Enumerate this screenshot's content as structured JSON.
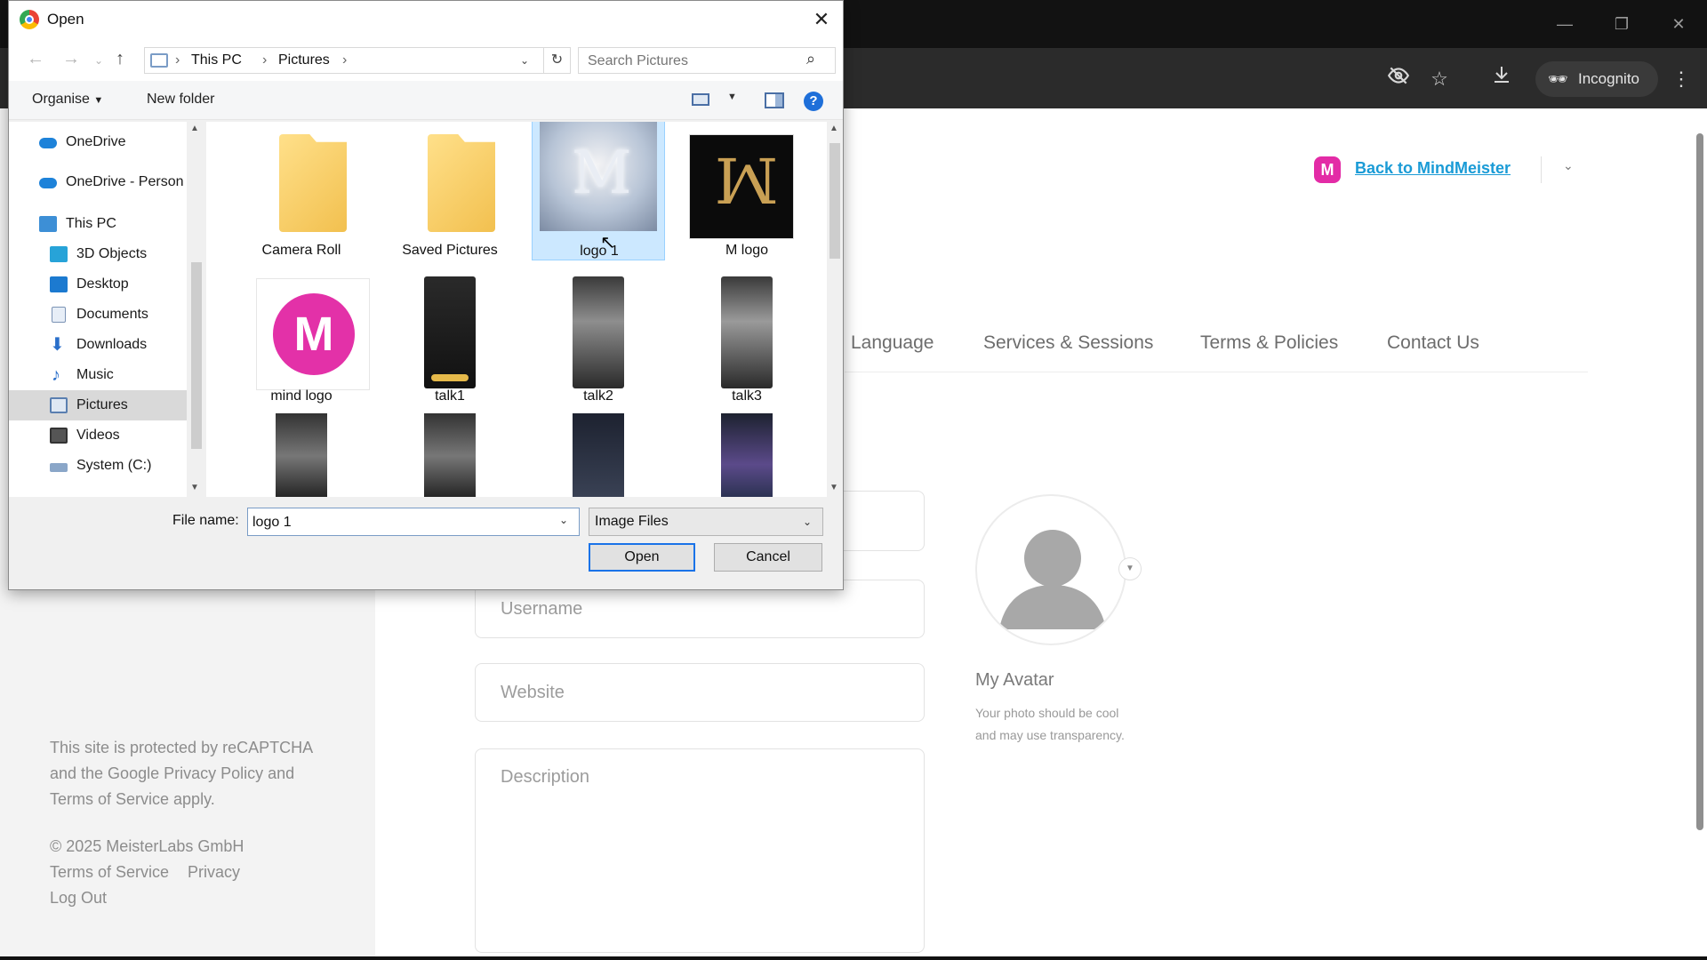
{
  "browser": {
    "incognito_label": "Incognito",
    "icons": [
      "eye-off-icon",
      "star-icon",
      "download-icon",
      "incognito-icon",
      "more-vert-icon"
    ]
  },
  "page": {
    "back_link": "Back to MindMeister",
    "logo_letter": "M",
    "tabs": [
      "Language",
      "Services & Sessions",
      "Terms & Policies",
      "Contact Us"
    ],
    "fields": {
      "username_placeholder": "Username",
      "website_placeholder": "Website",
      "description_placeholder": "Description"
    },
    "avatar": {
      "title": "My Avatar",
      "hint": "Your photo should be cool and may use transparency."
    },
    "footer": {
      "recaptcha_line1": "This site is protected by reCAPTCHA",
      "recaptcha_line2": "and the Google Privacy Policy and",
      "recaptcha_line3": "Terms of Service apply.",
      "copyright": "© 2025 MeisterLabs GmbH",
      "terms_link": "Terms of Service",
      "privacy_link": "Privacy",
      "logout_link": "Log Out"
    }
  },
  "dialog": {
    "title": "Open",
    "breadcrumb": [
      "This PC",
      "Pictures"
    ],
    "search_placeholder": "Search Pictures",
    "organise_label": "Organise",
    "new_folder_label": "New folder",
    "help_label": "?",
    "nav_items": [
      {
        "label": "OneDrive",
        "icon": "onedrive-icon"
      },
      {
        "label": "OneDrive - Person",
        "icon": "onedrive-icon"
      },
      {
        "label": "This PC",
        "icon": "computer-icon"
      },
      {
        "label": "3D Objects",
        "icon": "cube-icon"
      },
      {
        "label": "Desktop",
        "icon": "desktop-icon"
      },
      {
        "label": "Documents",
        "icon": "document-icon"
      },
      {
        "label": "Downloads",
        "icon": "download-arrow-icon"
      },
      {
        "label": "Music",
        "icon": "music-note-icon"
      },
      {
        "label": "Pictures",
        "icon": "pictures-icon",
        "selected": true
      },
      {
        "label": "Videos",
        "icon": "film-icon"
      },
      {
        "label": "System (C:)",
        "icon": "drive-icon"
      }
    ],
    "files": [
      {
        "label": "Camera Roll",
        "kind": "folder"
      },
      {
        "label": "Saved Pictures",
        "kind": "folder"
      },
      {
        "label": "logo 1",
        "kind": "image",
        "selected": true
      },
      {
        "label": "M logo",
        "kind": "image"
      },
      {
        "label": "mind logo",
        "kind": "image"
      },
      {
        "label": "talk1",
        "kind": "image"
      },
      {
        "label": "talk2",
        "kind": "image"
      },
      {
        "label": "talk3",
        "kind": "image"
      },
      {
        "label": "",
        "kind": "image"
      },
      {
        "label": "",
        "kind": "image"
      },
      {
        "label": "",
        "kind": "image"
      },
      {
        "label": "",
        "kind": "image"
      }
    ],
    "file_name_label": "File name:",
    "file_name_value": "logo 1",
    "file_type": "Image Files",
    "open_button": "Open",
    "cancel_button": "Cancel"
  }
}
